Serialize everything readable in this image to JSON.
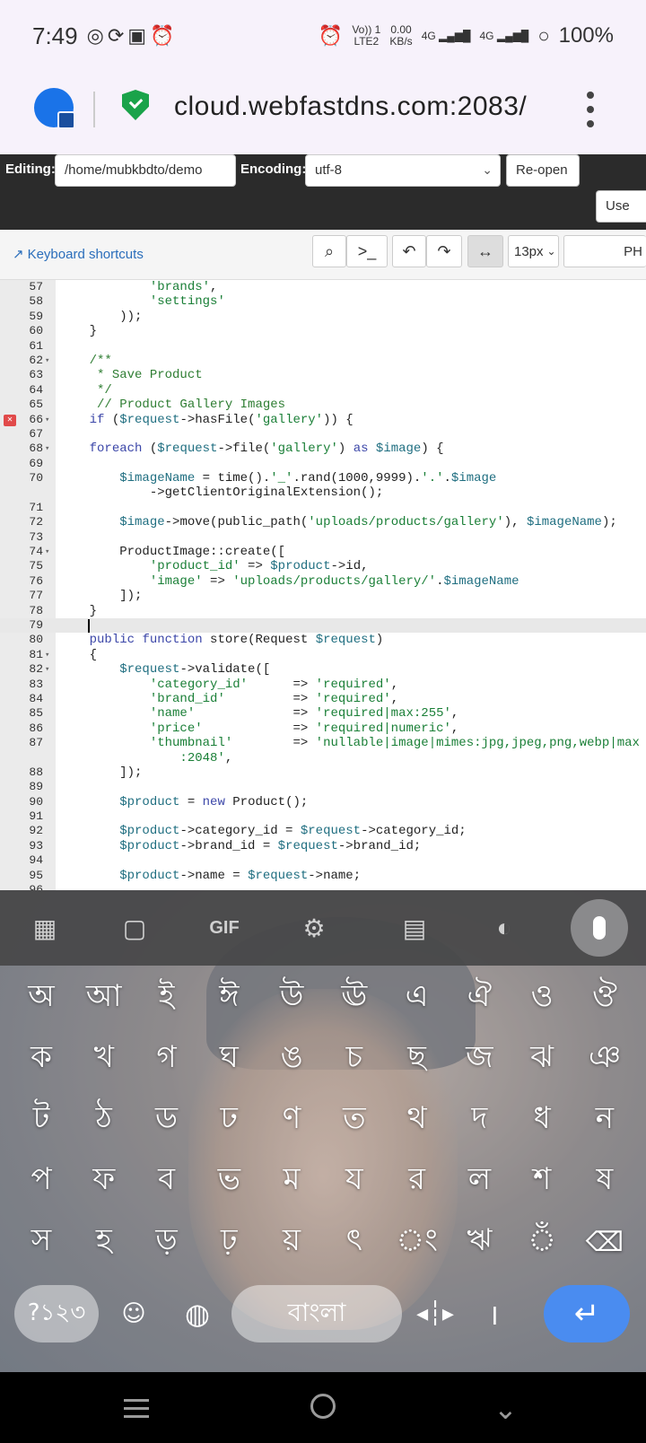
{
  "status_bar": {
    "time": "7:49",
    "net_top": "Vo)) 1",
    "net_bottom": "LTE2",
    "speed_value": "0.00",
    "speed_unit": "KB/s",
    "sig1": "4G",
    "sig2": "4G",
    "battery": "100%"
  },
  "browser": {
    "url": "cloud.webfastdns.com:2083/"
  },
  "editor": {
    "editing_label": "Editing:",
    "path_value": "/home/mubkbdto/demo",
    "encoding_label": "Encoding:",
    "encoding_value": "utf-8",
    "reopen_label": "Re-open",
    "use_label": "Use"
  },
  "toolbar": {
    "keyboard_shortcuts": "Keyboard shortcuts",
    "font_size": "13px",
    "mode": "PH"
  },
  "code_lines": [
    {
      "num": "57",
      "fold": false,
      "err": false,
      "tall": false,
      "cur": false,
      "html": "            <span class='str'>'brands'</span>,"
    },
    {
      "num": "58",
      "fold": false,
      "err": false,
      "tall": false,
      "cur": false,
      "html": "            <span class='str'>'settings'</span>"
    },
    {
      "num": "59",
      "fold": false,
      "err": false,
      "tall": false,
      "cur": false,
      "html": "        ));"
    },
    {
      "num": "60",
      "fold": false,
      "err": false,
      "tall": false,
      "cur": false,
      "html": "    }"
    },
    {
      "num": "61",
      "fold": false,
      "err": false,
      "tall": false,
      "cur": false,
      "html": ""
    },
    {
      "num": "62",
      "fold": true,
      "err": false,
      "tall": false,
      "cur": false,
      "html": "    <span class='cm'>/**</span>"
    },
    {
      "num": "63",
      "fold": false,
      "err": false,
      "tall": false,
      "cur": false,
      "html": "    <span class='cm'> * Save Product</span>"
    },
    {
      "num": "64",
      "fold": false,
      "err": false,
      "tall": false,
      "cur": false,
      "html": "    <span class='cm'> */</span>"
    },
    {
      "num": "65",
      "fold": false,
      "err": false,
      "tall": false,
      "cur": false,
      "html": "    <span class='cm'> // Product Gallery Images</span>"
    },
    {
      "num": "66",
      "fold": true,
      "err": true,
      "tall": false,
      "cur": false,
      "html": "    <span class='kw'>if</span> (<span class='var'>$request</span>-&gt;hasFile(<span class='str'>'gallery'</span>)) {"
    },
    {
      "num": "67",
      "fold": false,
      "err": false,
      "tall": false,
      "cur": false,
      "html": ""
    },
    {
      "num": "68",
      "fold": true,
      "err": false,
      "tall": false,
      "cur": false,
      "html": "    <span class='kw'>foreach</span> (<span class='var'>$request</span>-&gt;file(<span class='str'>'gallery'</span>) <span class='kw'>as</span> <span class='var'>$image</span>) {"
    },
    {
      "num": "69",
      "fold": false,
      "err": false,
      "tall": false,
      "cur": false,
      "html": ""
    },
    {
      "num": "70",
      "fold": false,
      "err": false,
      "tall": true,
      "cur": false,
      "html": "        <span class='var'>$imageName</span> = time().<span class='str'>'_'</span>.rand(1000,9999).<span class='str'>'.'</span>.<span class='var'>$image</span>\n            -&gt;getClientOriginalExtension();"
    },
    {
      "num": "71",
      "fold": false,
      "err": false,
      "tall": false,
      "cur": false,
      "html": ""
    },
    {
      "num": "72",
      "fold": false,
      "err": false,
      "tall": false,
      "cur": false,
      "html": "        <span class='var'>$image</span>-&gt;move(public_path(<span class='str'>'uploads/products/gallery'</span>), <span class='var'>$imageName</span>);"
    },
    {
      "num": "73",
      "fold": false,
      "err": false,
      "tall": false,
      "cur": false,
      "html": ""
    },
    {
      "num": "74",
      "fold": true,
      "err": false,
      "tall": false,
      "cur": false,
      "html": "        ProductImage::create(["
    },
    {
      "num": "75",
      "fold": false,
      "err": false,
      "tall": false,
      "cur": false,
      "html": "            <span class='str'>'product_id'</span> =&gt; <span class='var'>$product</span>-&gt;id,"
    },
    {
      "num": "76",
      "fold": false,
      "err": false,
      "tall": false,
      "cur": false,
      "html": "            <span class='str'>'image'</span> =&gt; <span class='str'>'uploads/products/gallery/'</span>.<span class='var'>$imageName</span>"
    },
    {
      "num": "77",
      "fold": false,
      "err": false,
      "tall": false,
      "cur": false,
      "html": "        ]);"
    },
    {
      "num": "78",
      "fold": false,
      "err": false,
      "tall": false,
      "cur": false,
      "html": "    }"
    },
    {
      "num": "79",
      "fold": false,
      "err": false,
      "tall": false,
      "cur": true,
      "html": ""
    },
    {
      "num": "80",
      "fold": false,
      "err": false,
      "tall": false,
      "cur": false,
      "html": "    <span class='kw'>public</span> <span class='kw'>function</span> store(Request <span class='var'>$request</span>)"
    },
    {
      "num": "81",
      "fold": true,
      "err": false,
      "tall": false,
      "cur": false,
      "html": "    {"
    },
    {
      "num": "82",
      "fold": true,
      "err": false,
      "tall": false,
      "cur": false,
      "html": "        <span class='var'>$request</span>-&gt;validate(["
    },
    {
      "num": "83",
      "fold": false,
      "err": false,
      "tall": false,
      "cur": false,
      "html": "            <span class='str'>'category_id'</span>      =&gt; <span class='str'>'required'</span>,"
    },
    {
      "num": "84",
      "fold": false,
      "err": false,
      "tall": false,
      "cur": false,
      "html": "            <span class='str'>'brand_id'</span>         =&gt; <span class='str'>'required'</span>,"
    },
    {
      "num": "85",
      "fold": false,
      "err": false,
      "tall": false,
      "cur": false,
      "html": "            <span class='str'>'name'</span>             =&gt; <span class='str'>'required|max:255'</span>,"
    },
    {
      "num": "86",
      "fold": false,
      "err": false,
      "tall": false,
      "cur": false,
      "html": "            <span class='str'>'price'</span>            =&gt; <span class='str'>'required|numeric'</span>,"
    },
    {
      "num": "87",
      "fold": false,
      "err": false,
      "tall": true,
      "cur": false,
      "html": "            <span class='str'>'thumbnail'</span>        =&gt; <span class='str'>'nullable|image|mimes:jpg,jpeg,png,webp|max</span>\n                <span class='str'>:2048'</span>,"
    },
    {
      "num": "88",
      "fold": false,
      "err": false,
      "tall": false,
      "cur": false,
      "html": "        ]);"
    },
    {
      "num": "89",
      "fold": false,
      "err": false,
      "tall": false,
      "cur": false,
      "html": ""
    },
    {
      "num": "90",
      "fold": false,
      "err": false,
      "tall": false,
      "cur": false,
      "html": "        <span class='var'>$product</span> = <span class='kw'>new</span> Product();"
    },
    {
      "num": "91",
      "fold": false,
      "err": false,
      "tall": false,
      "cur": false,
      "html": ""
    },
    {
      "num": "92",
      "fold": false,
      "err": false,
      "tall": false,
      "cur": false,
      "html": "        <span class='var'>$product</span>-&gt;category_id = <span class='var'>$request</span>-&gt;category_id;"
    },
    {
      "num": "93",
      "fold": false,
      "err": false,
      "tall": false,
      "cur": false,
      "html": "        <span class='var'>$product</span>-&gt;brand_id = <span class='var'>$request</span>-&gt;brand_id;"
    },
    {
      "num": "94",
      "fold": false,
      "err": false,
      "tall": false,
      "cur": false,
      "html": ""
    },
    {
      "num": "95",
      "fold": false,
      "err": false,
      "tall": false,
      "cur": false,
      "html": "        <span class='var'>$product</span>-&gt;name = <span class='var'>$request</span>-&gt;name;"
    },
    {
      "num": "96",
      "fold": false,
      "err": false,
      "tall": false,
      "cur": false,
      "html": ""
    }
  ],
  "keyboard": {
    "rows": [
      [
        "অ",
        "আ",
        "ই",
        "ঈ",
        "উ",
        "ঊ",
        "এ",
        "ঐ",
        "ও",
        "ঔ"
      ],
      [
        "ক",
        "খ",
        "গ",
        "ঘ",
        "ঙ",
        "চ",
        "ছ",
        "জ",
        "ঝ",
        "ঞ"
      ],
      [
        "ট",
        "ঠ",
        "ড",
        "ঢ",
        "ণ",
        "ত",
        "থ",
        "দ",
        "ধ",
        "ন"
      ],
      [
        "প",
        "ফ",
        "ব",
        "ভ",
        "ম",
        "য",
        "র",
        "ল",
        "শ",
        "ষ"
      ],
      [
        "স",
        "হ",
        "ড়",
        "ঢ়",
        "য়",
        "ৎ",
        "◌ং",
        "ঋ",
        "◌ঁ"
      ]
    ],
    "numbers_key": "?১২৩",
    "space_label": "বাংলা",
    "danda_key": "।"
  },
  "accent_colors": {
    "enter_key": "#4a8cf0",
    "link": "#2a6ebb",
    "shield": "#1aa34a"
  }
}
